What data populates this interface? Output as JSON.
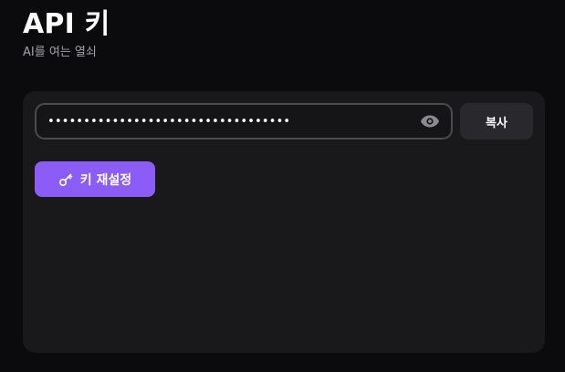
{
  "header": {
    "title": "API 키",
    "subtitle": "AI를 여는 열쇠"
  },
  "api_key": {
    "masked_value": "••••••••••••••••••••••••••••••••••",
    "visibility_icon": "eye-icon"
  },
  "actions": {
    "copy_label": "복사",
    "reset_label": "키 재설정",
    "reset_icon": "key-icon"
  },
  "colors": {
    "accent": "#8b5cf6",
    "background": "#0b0b0d",
    "card": "#19191c"
  }
}
